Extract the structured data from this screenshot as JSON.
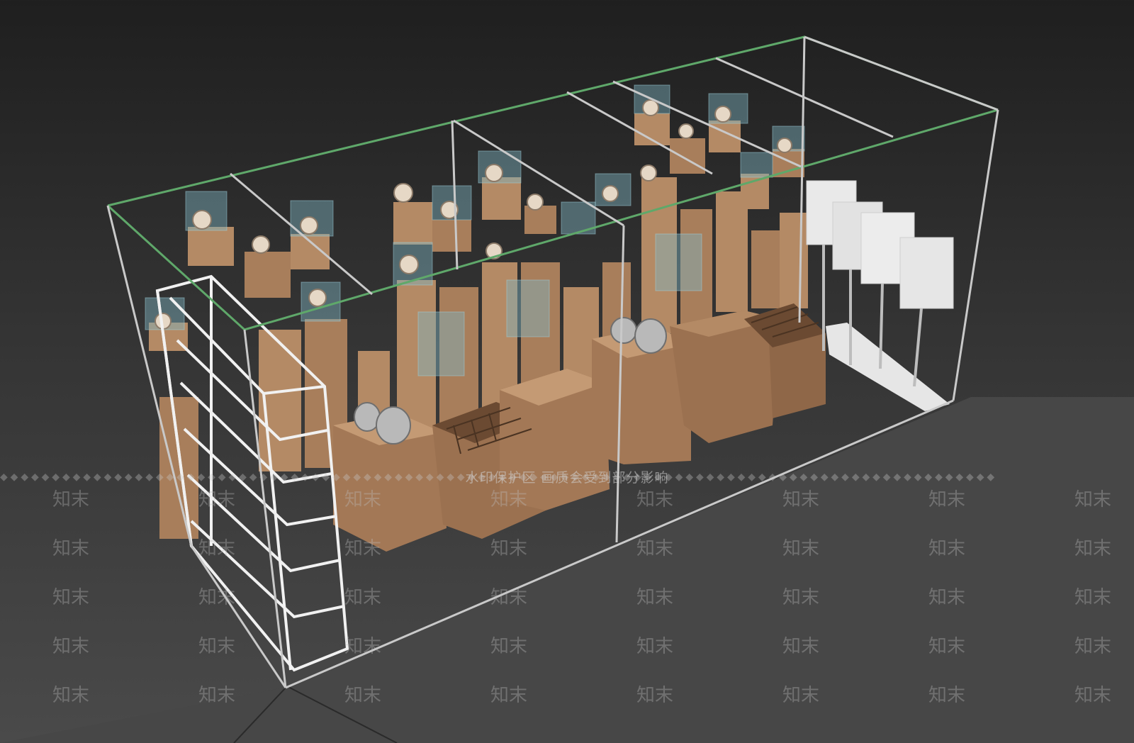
{
  "viewport": {
    "label": "Perspective viewport",
    "colors": {
      "background_top": "#1f1f1f",
      "background_bottom": "#4a4a4a",
      "frame_edge": "#c9c9c9",
      "selected_edge": "#5fa86a",
      "wood_light": "#b48a65",
      "wood_dark": "#8a6447",
      "glass": "#7fb3c0",
      "white_panel": "#e9e9e9"
    }
  },
  "watermark": {
    "banner_text": "水印保护区   画质会受到部分影响",
    "tile_text": "知末"
  }
}
